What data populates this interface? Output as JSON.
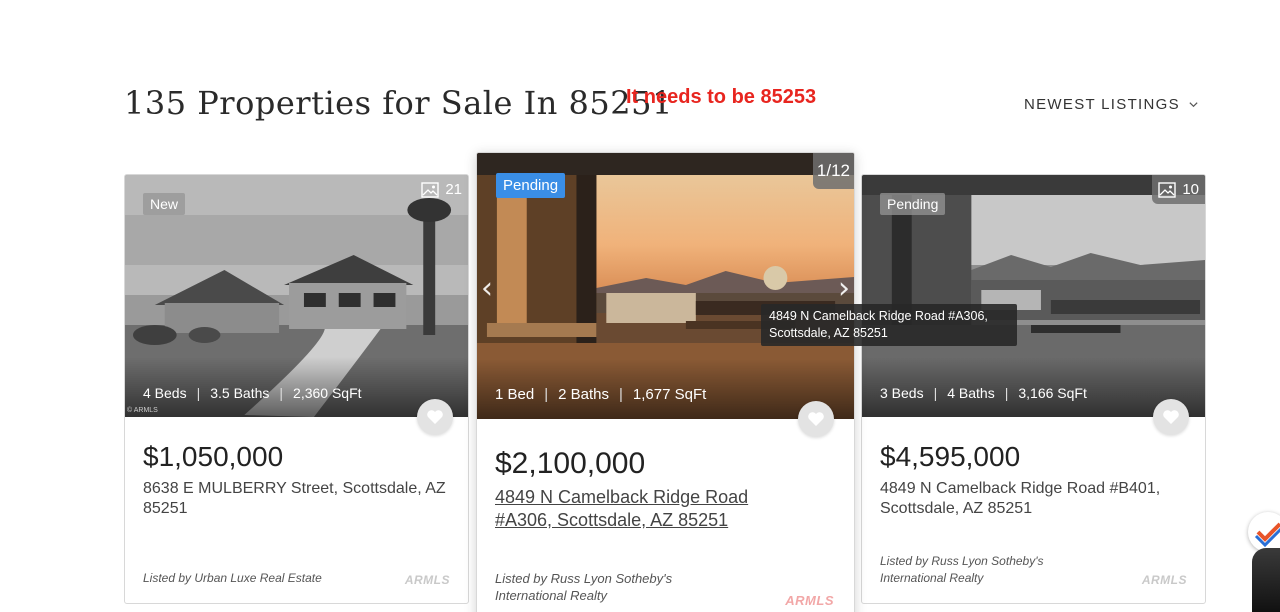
{
  "header": {
    "title": "135 Properties for Sale In 85251",
    "annotation": "It needs to be 85253",
    "sort_label": "NEWEST LISTINGS"
  },
  "listings": [
    {
      "badge": "New",
      "photo_count": "21",
      "beds": "4 Beds",
      "baths": "3.5 Baths",
      "sqft": "2,360 SqFt",
      "price": "$1,050,000",
      "address": "8638 E MULBERRY Street, Scottsdale, AZ 85251",
      "listed_by": "Listed by Urban Luxe Real Estate",
      "mls": "ARMLS",
      "photo_credit": "© ARMLS"
    },
    {
      "badge": "Pending",
      "photo_count": "1/12",
      "beds": "1 Bed",
      "baths": "2 Baths",
      "sqft": "1,677 SqFt",
      "price": "$2,100,000",
      "address_line1": "4849 N Camelback Ridge Road",
      "address_line2": "#A306, Scottsdale, AZ 85251",
      "listed_by_line1": "Listed by Russ Lyon Sotheby's",
      "listed_by_line2": "International Realty",
      "mls": "ARMLS",
      "tooltip_line1": "4849 N Camelback Ridge Road #A306,",
      "tooltip_line2": "Scottsdale, AZ 85251"
    },
    {
      "badge": "Pending",
      "photo_count": "10",
      "beds": "3 Beds",
      "baths": "4 Baths",
      "sqft": "3,166 SqFt",
      "price": "$4,595,000",
      "address": "4849 N Camelback Ridge Road #B401, Scottsdale, AZ 85251",
      "listed_by": "Listed by Russ Lyon Sotheby's International Realty",
      "mls": "ARMLS"
    }
  ],
  "stat_separator": "|",
  "icons": [
    "image-icon",
    "heart-icon",
    "chevron-down-icon",
    "chevron-left-icon",
    "chevron-right-icon"
  ],
  "colors": {
    "pending_badge": "#3a8ee6",
    "annotation": "#e8251f",
    "fav_bg": "#e3e3e3"
  }
}
